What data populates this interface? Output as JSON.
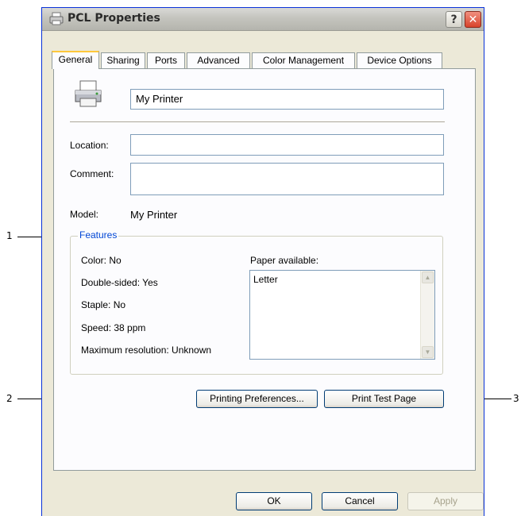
{
  "callouts": [
    "1",
    "2",
    "3"
  ],
  "window": {
    "title": "PCL  Properties",
    "help_label": "?",
    "close_label": "✕"
  },
  "tabs": [
    {
      "label": "General",
      "active": true
    },
    {
      "label": "Sharing"
    },
    {
      "label": "Ports"
    },
    {
      "label": "Advanced"
    },
    {
      "label": "Color Management"
    },
    {
      "label": "Device Options"
    }
  ],
  "general": {
    "printer_name": "My Printer",
    "location_label": "Location:",
    "location_value": "",
    "comment_label": "Comment:",
    "comment_value": "",
    "model_label": "Model:",
    "model_value": "My Printer"
  },
  "features": {
    "title": "Features",
    "color": "Color: No",
    "double_sided": "Double-sided: Yes",
    "staple": "Staple: No",
    "speed": "Speed: 38 ppm",
    "max_resolution": "Maximum resolution: Unknown",
    "paper_label": "Paper available:",
    "paper_items": [
      "Letter"
    ]
  },
  "buttons": {
    "printing_preferences": "Printing Preferences...",
    "print_test_page": "Print Test Page",
    "ok": "OK",
    "cancel": "Cancel",
    "apply": "Apply"
  }
}
